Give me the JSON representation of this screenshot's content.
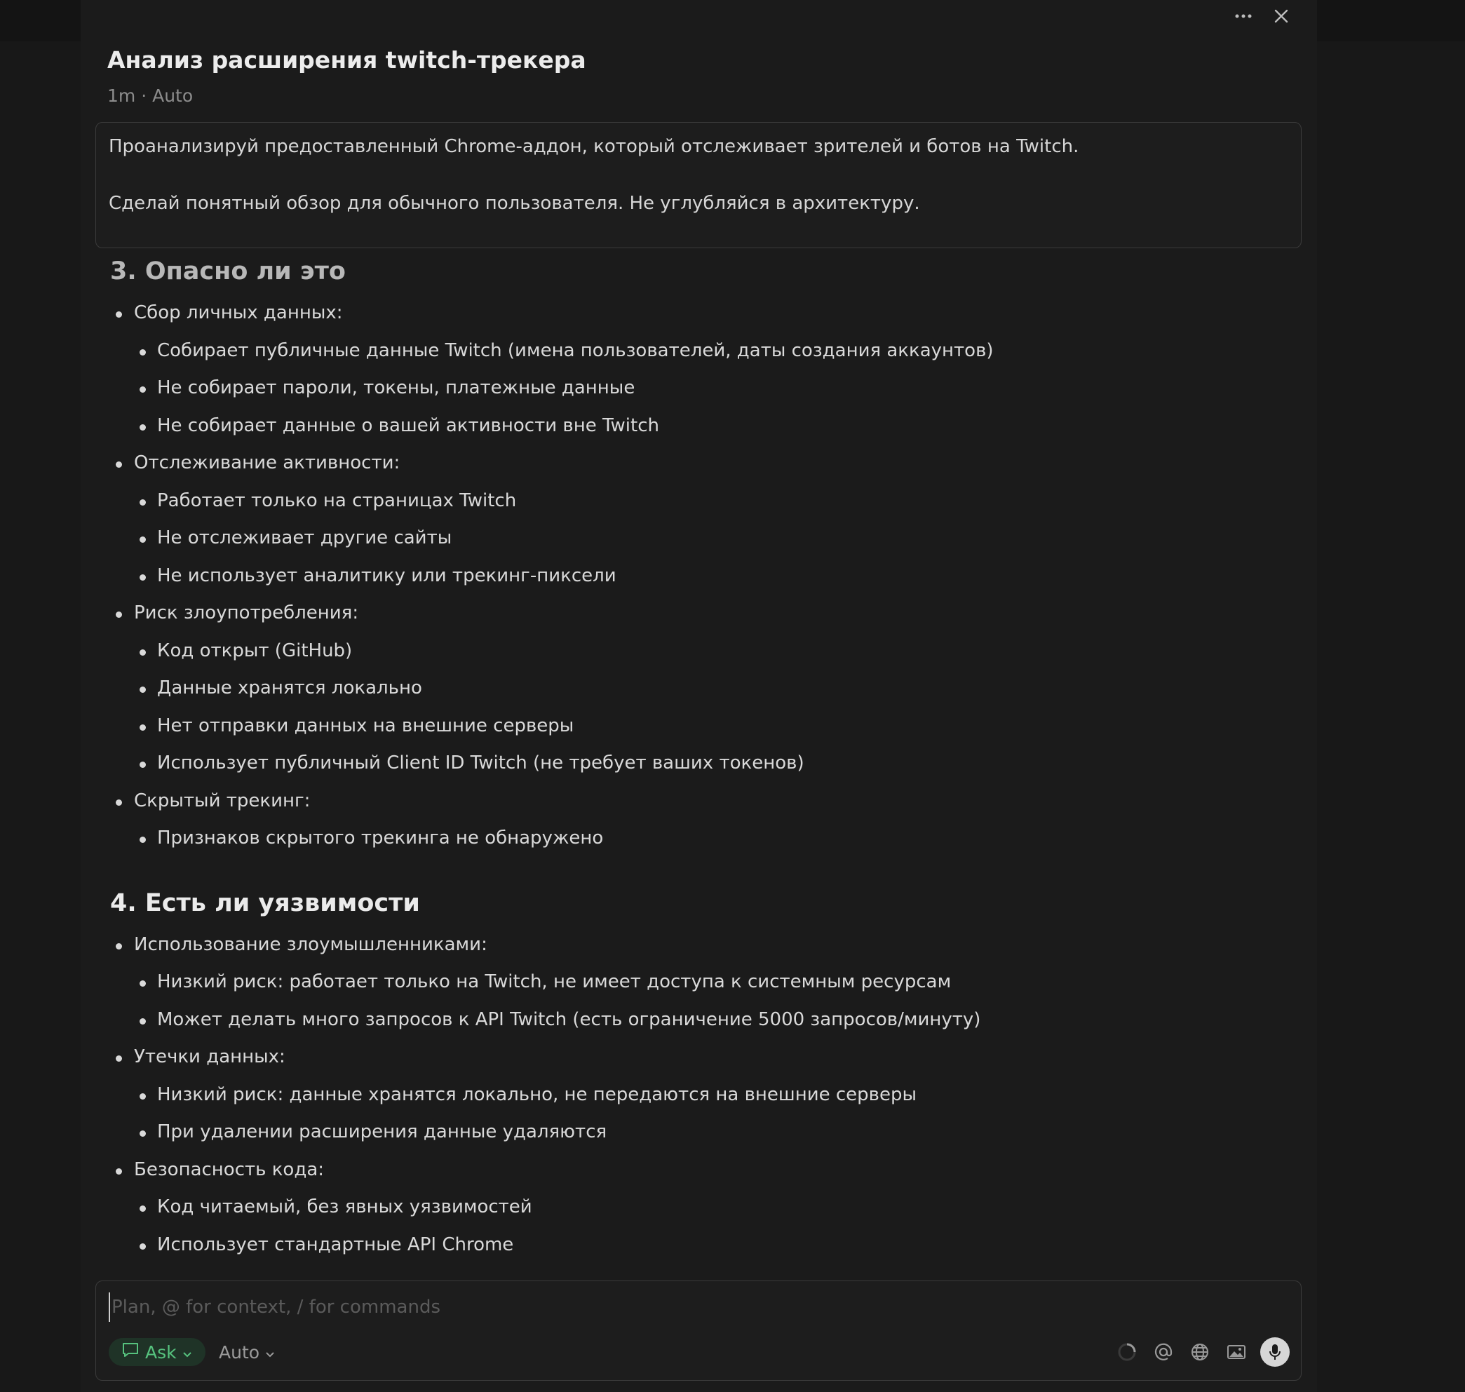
{
  "window": {
    "more_icon": "more-horizontal-icon",
    "close_icon": "close-icon"
  },
  "header": {
    "title": "Анализ расширения twitch-трекера",
    "meta": "1m · Auto"
  },
  "prompt": {
    "line1": "Проанализируй предоставленный Chrome-аддон, который отслеживает зрителей и ботов на Twitch.",
    "line2": "Сделай понятный обзор для обычного пользователя. Не углубляйся в архитектуру."
  },
  "sections": [
    {
      "heading": "3. Опасно ли это",
      "groups": [
        {
          "label": "Сбор личных данных:",
          "items": [
            "Собирает публичные данные Twitch (имена пользователей, даты создания аккаунтов)",
            "Не собирает пароли, токены, платежные данные",
            "Не собирает данные о вашей активности вне Twitch"
          ]
        },
        {
          "label": "Отслеживание активности:",
          "items": [
            "Работает только на страницах Twitch",
            "Не отслеживает другие сайты",
            "Не использует аналитику или трекинг-пиксели"
          ]
        },
        {
          "label": "Риск злоупотребления:",
          "items": [
            "Код открыт (GitHub)",
            "Данные хранятся локально",
            "Нет отправки данных на внешние серверы",
            "Использует публичный Client ID Twitch (не требует ваших токенов)"
          ]
        },
        {
          "label": "Скрытый трекинг:",
          "items": [
            "Признаков скрытого трекинга не обнаружено"
          ]
        }
      ]
    },
    {
      "heading": "4. Есть ли уязвимости",
      "groups": [
        {
          "label": "Использование злоумышленниками:",
          "items": [
            "Низкий риск: работает только на Twitch, не имеет доступа к системным ресурсам",
            "Может делать много запросов к API Twitch (есть ограничение 5000 запросов/минуту)"
          ]
        },
        {
          "label": "Утечки данных:",
          "items": [
            "Низкий риск: данные хранятся локально, не передаются на внешние серверы",
            "При удалении расширения данные удаляются"
          ]
        },
        {
          "label": "Безопасность кода:",
          "items": [
            "Код читаемый, без явных уязвимостей",
            "Использует стандартные API Chrome"
          ]
        }
      ]
    }
  ],
  "composer": {
    "placeholder": "Plan, @ for context, / for commands",
    "mode_label": "Ask",
    "model_label": "Auto",
    "tools": [
      "loading-spinner-icon",
      "at-mention-icon",
      "globe-icon",
      "image-icon",
      "microphone-icon"
    ]
  },
  "colors": {
    "background": "#181818",
    "panel": "#1b1b1b",
    "accent_green": "#56c27e"
  }
}
